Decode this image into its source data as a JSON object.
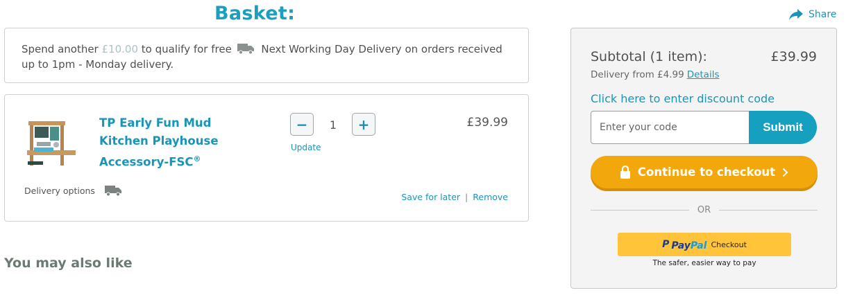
{
  "page": {
    "title": "Basket:",
    "share_label": "Share"
  },
  "notice": {
    "text_before": "Spend another",
    "amount": "£10.00",
    "text_middle": "to qualify for free",
    "text_after": "Next Working Day Delivery on orders received up to 1pm - Monday delivery."
  },
  "item": {
    "name": "TP Early Fun Mud Kitchen Playhouse Accessory-FSC",
    "name_suffix": "®",
    "quantity": "1",
    "minus_label": "−",
    "plus_label": "+",
    "update_label": "Update",
    "price": "£39.99",
    "delivery_options_label": "Delivery options",
    "save_for_later_label": "Save for later",
    "separator": "|",
    "remove_label": "Remove"
  },
  "recommendations": {
    "heading": "You may also like"
  },
  "summary": {
    "subtotal_label": "Subtotal (1 item):",
    "subtotal_value": "£39.99",
    "delivery_from": "Delivery from £4.99",
    "details_label": "Details",
    "discount_link": "Click here to enter discount code",
    "code_placeholder": "Enter your code",
    "submit_label": "Submit",
    "checkout_label": "Continue to checkout",
    "or_label": "OR",
    "paypal_p": "P",
    "paypal_pay": "Pay",
    "paypal_pal": "Pal",
    "paypal_checkout": "Checkout",
    "paypal_tagline": "The safer, easier way to pay"
  },
  "colors": {
    "brand_teal": "#1aa0be",
    "link_blue": "#1a95b8",
    "checkout_orange": "#f2a80c",
    "paypal_yellow": "#ffc43a"
  },
  "icons": [
    "share-arrow-icon",
    "delivery-truck-icon",
    "lock-icon",
    "chevron-right-icon",
    "paypal-logo-icon"
  ]
}
